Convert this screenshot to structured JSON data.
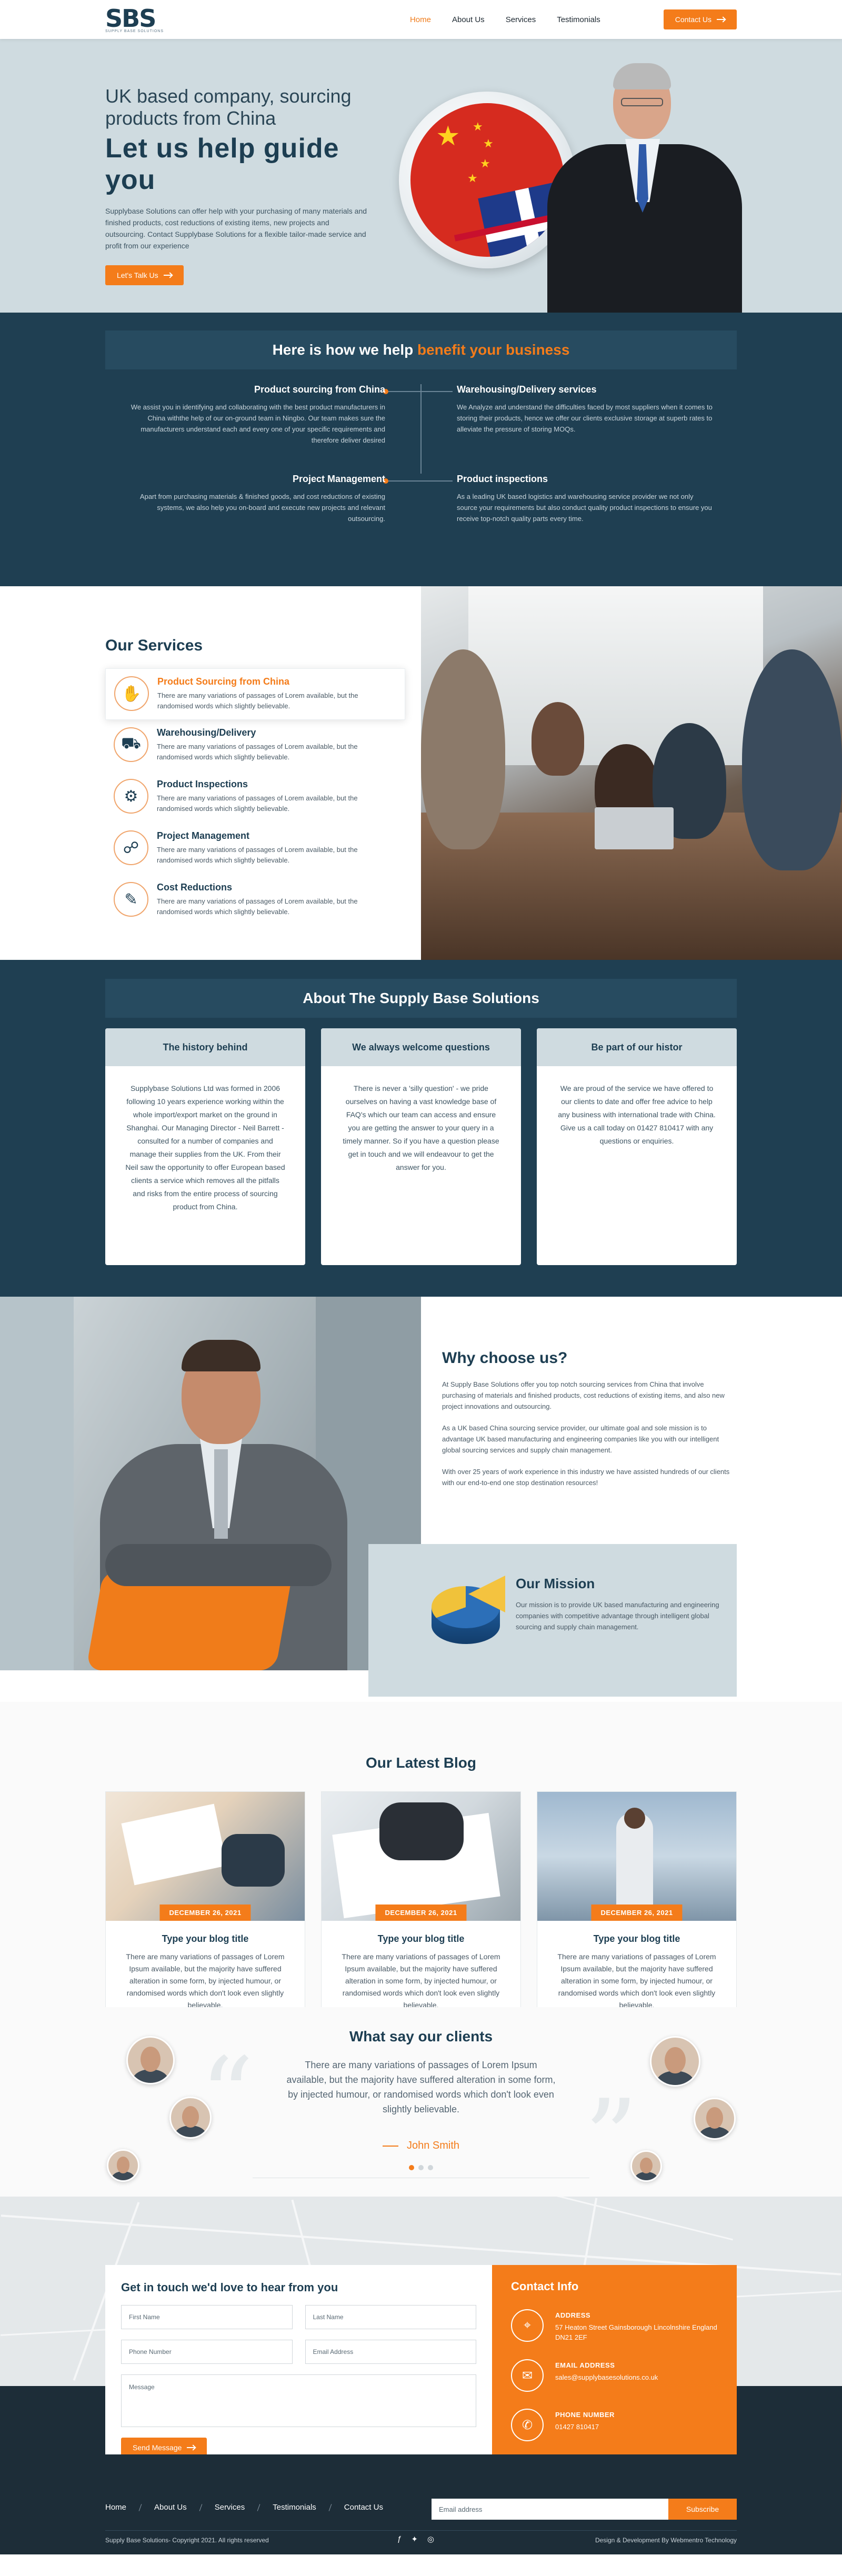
{
  "brand": {
    "logo_text": "SBS",
    "logo_sub": "SUPPLY BASE SOLUTIONS"
  },
  "nav": {
    "items": [
      "Home",
      "About Us",
      "Services",
      "Testimonials"
    ],
    "active": "Home",
    "contact_label": "Contact Us"
  },
  "hero": {
    "subtitle": "UK based company, sourcing products from China",
    "title": "Let us help guide you",
    "description": "Supplybase Solutions can offer help with your purchasing of many materials and finished products, cost reductions of existing items, new projects and outsourcing. Contact Supplybase Solutions for a flexible tailor-made service and profit from our experience",
    "cta": "Let's Talk Us"
  },
  "help": {
    "title_main": "Here is how we help",
    "title_accent": "benefit your business",
    "items": [
      {
        "title": "Product sourcing from China",
        "text": "We assist you in identifying and collaborating with the best product manufacturers in China withthe help of our on-ground team in Ningbo. Our team makes sure the manufacturers understand each and every one of your specific requirements and therefore deliver desired"
      },
      {
        "title": "Warehousing/Delivery services",
        "text": "We Analyze and understand the difficulties faced by most suppliers when it comes to storing their products, hence we offer our clients exclusive storage at superb rates to alleviate the pressure of storing MOQs."
      },
      {
        "title": "Project Management",
        "text": "Apart from purchasing materials & finished goods, and cost reductions of existing systems, we also help you on-board and execute new projects and relevant outsourcing."
      },
      {
        "title": "Product inspections",
        "text": "As a leading UK based logistics and warehousing service provider we not only source your requirements but also conduct quality product inspections to ensure you receive top-notch quality parts every time."
      }
    ]
  },
  "services": {
    "title": "Our Services",
    "items": [
      {
        "title": "Product Sourcing from China",
        "text": "There are many variations of passages of Lorem available, but the randomised words which slightly believable.",
        "icon": "handshake-icon"
      },
      {
        "title": "Warehousing/Delivery",
        "text": "There are many variations of passages of Lorem available, but the randomised words which slightly believable.",
        "icon": "truck-icon"
      },
      {
        "title": "Product Inspections",
        "text": "There are many variations of passages of Lorem available, but the randomised words which slightly believable.",
        "icon": "inspection-icon"
      },
      {
        "title": "Project Management",
        "text": "There are many variations of passages of Lorem available, but the randomised words which slightly believable.",
        "icon": "project-icon"
      },
      {
        "title": "Cost Reductions",
        "text": "There are many variations of passages of Lorem available, but the randomised words which slightly believable.",
        "icon": "cost-icon"
      }
    ]
  },
  "about": {
    "title": "About The Supply Base Solutions",
    "cards": [
      {
        "title": "The history behind",
        "text": "Supplybase Solutions Ltd was formed in 2006 following 10 years experience working within the whole import/export market on the ground in Shanghai. Our Managing Director - Neil Barrett - consulted for a number of companies and manage their supplies from the UK. From their Neil saw the opportunity to offer European based clients a service which removes all the pitfalls and risks from the entire process of sourcing product from China."
      },
      {
        "title": "We always welcome questions",
        "text": "There is never a 'silly question' - we pride ourselves on having a vast knowledge base of FAQ's which our team can access and ensure you are getting the answer to your query in a timely manner. So if you have a question please get in touch and we will endeavour to get the answer for you."
      },
      {
        "title": "Be part of our histor",
        "text": "We are proud of the service we have offered to our clients to date and offer free advice to help any business with international trade with China. Give us a call today on 01427 810417 with any questions or enquiries."
      }
    ]
  },
  "why": {
    "title": "Why choose us?",
    "paragraphs": [
      "At Supply Base Solutions offer you top notch sourcing services from China that involve purchasing of materials and finished products, cost reductions of existing items, and also new project innovations and outsourcing.",
      "As a UK based China sourcing service provider, our ultimate goal and sole mission is to advantage UK based manufacturing and engineering companies like you with our intelligent global sourcing services and supply chain management.",
      "With over 25 years of work experience in this industry we have assisted hundreds of our clients with our end-to-end one stop destination resources!"
    ],
    "mission_title": "Our Mission",
    "mission_text": "Our mission is to provide UK based manufacturing and engineering companies with competitive advantage through intelligent global sourcing and supply chain management."
  },
  "blog": {
    "title": "Our Latest Blog",
    "posts": [
      {
        "date": "DECEMBER 26, 2021",
        "title": "Type your blog title",
        "text": "There are many variations of passages of Lorem Ipsum available, but the majority have suffered alteration in some form, by injected humour, or randomised words which don't look even slightly believable."
      },
      {
        "date": "DECEMBER 26, 2021",
        "title": "Type your blog title",
        "text": "There are many variations of passages of Lorem Ipsum available, but the majority have suffered alteration in some form, by injected humour, or randomised words which don't look even slightly believable."
      },
      {
        "date": "DECEMBER 26, 2021",
        "title": "Type your blog title",
        "text": "There are many variations of passages of Lorem Ipsum available, but the majority have suffered alteration in some form, by injected humour, or randomised words which don't look even slightly believable."
      }
    ]
  },
  "testimonials": {
    "title": "What say our clients",
    "quote": "There are many variations of passages of Lorem Ipsum available, but the majority have suffered alteration in some form, by injected humour, or randomised words which don't look even slightly believable.",
    "name": "John Smith",
    "active_dot": 0,
    "dot_count": 3
  },
  "contact": {
    "form_title": "Get in touch we'd love to hear from you",
    "first_name_placeholder": "First Name",
    "last_name_placeholder": "Last Name",
    "phone_placeholder": "Phone Number",
    "email_placeholder": "Email Address",
    "message_placeholder": "Message",
    "send_label": "Send Message",
    "info_title": "Contact Info",
    "address_label": "ADDRESS",
    "address_value": "57 Heaton Street Gainsborough Lincolnshire England DN21 2EF",
    "email_label": "EMAIL ADDRESS",
    "email_value": "sales@supplybasesolutions.co.uk",
    "phone_label": "PHONE NUMBER",
    "phone_value": "01427 810417"
  },
  "footer": {
    "links": [
      "Home",
      "About Us",
      "Services",
      "Testimonials",
      "Contact Us"
    ],
    "newsletter_placeholder": "Email address",
    "subscribe_label": "Subscribe",
    "copyright": "Supply Base Solutions- Copyright 2021. All rights reserved",
    "credit": "Design & Development By Webmentro Technology"
  },
  "colors": {
    "accent": "#f47c1a",
    "primary_dark": "#1f3f52",
    "light_panel": "#cfdbe0"
  }
}
